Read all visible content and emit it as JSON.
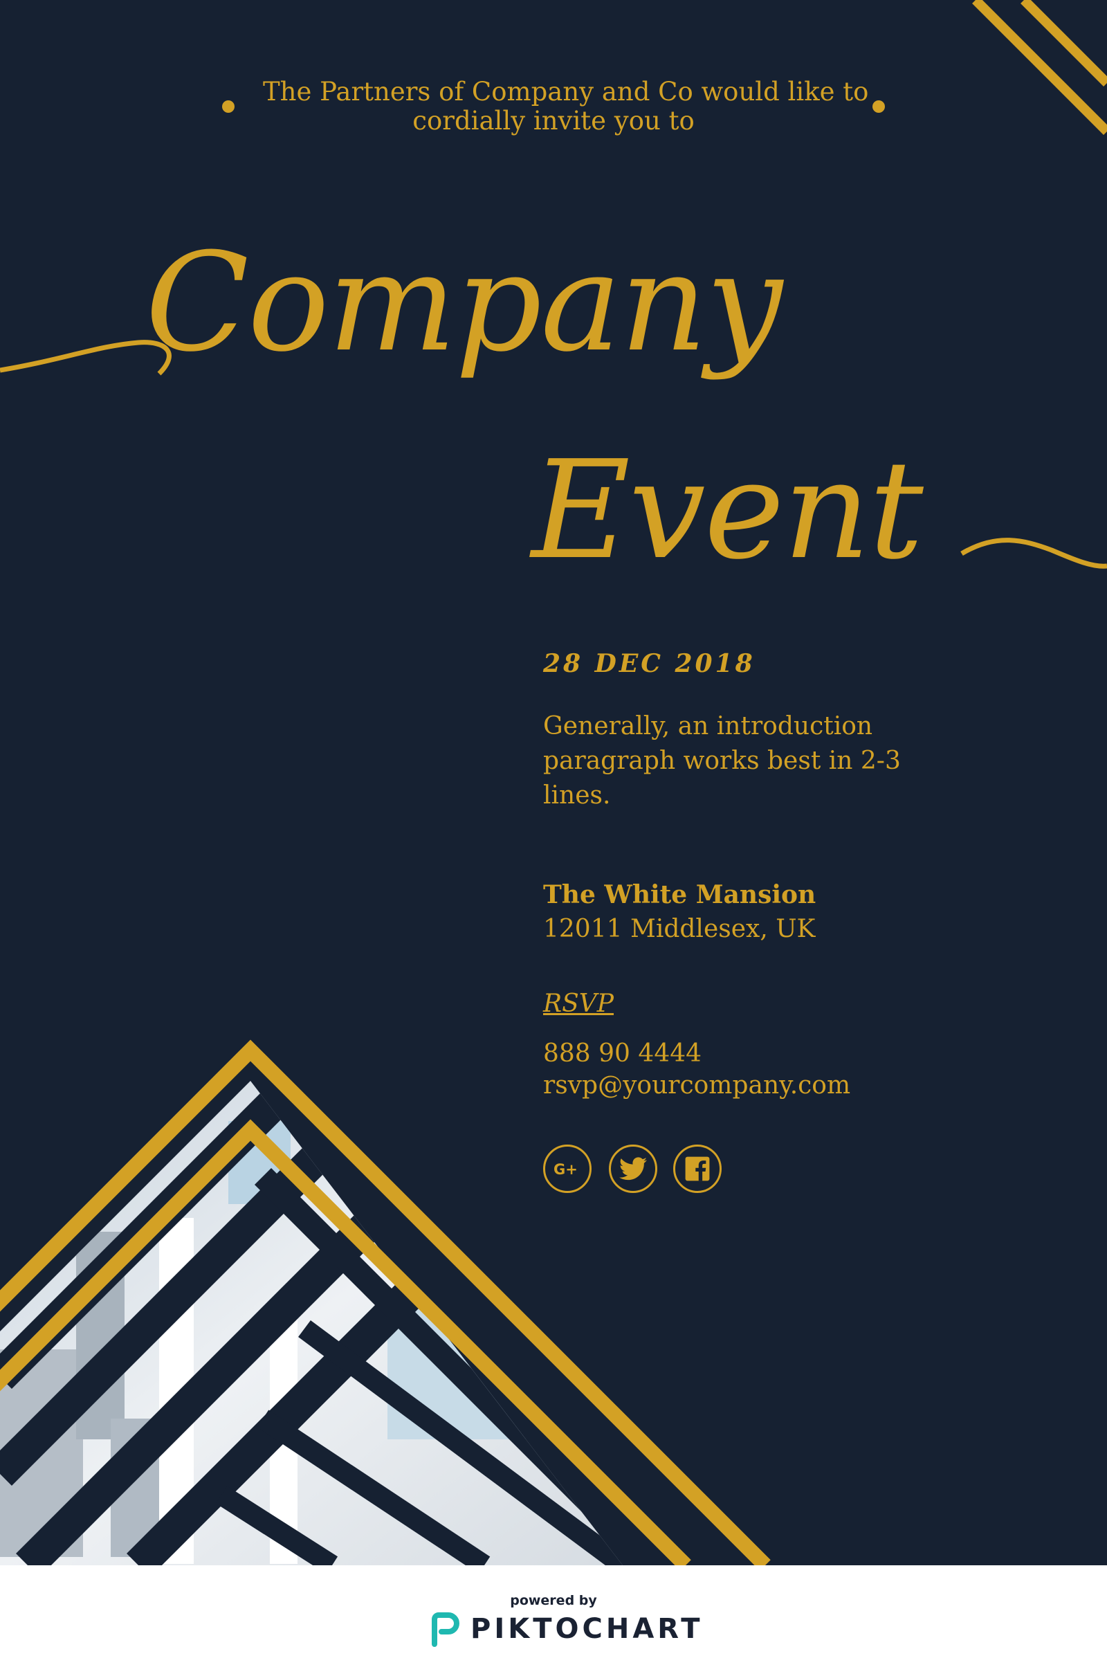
{
  "intro": {
    "line1": "The Partners of Company and Co would like to",
    "line2": "cordially invite you to"
  },
  "title": {
    "line1": "Company",
    "line2": "Event"
  },
  "event": {
    "date": "28 DEC 2018",
    "description": "Generally, an introduction paragraph works best in 2-3 lines.",
    "venue": "The White Mansion",
    "address": "12011 Middlesex, UK",
    "rsvp_label": "RSVP",
    "phone": "888 90 4444",
    "email": "rsvp@yourcompany.com"
  },
  "social": [
    "google-plus-icon",
    "twitter-icon",
    "facebook-icon"
  ],
  "footer": {
    "powered_by": "powered by",
    "brand": "PIKTOCHART"
  },
  "colors": {
    "background": "#162132",
    "gold": "#d3a125",
    "footer_bg": "#ffffff",
    "brand_accent": "#1fb8b0"
  }
}
